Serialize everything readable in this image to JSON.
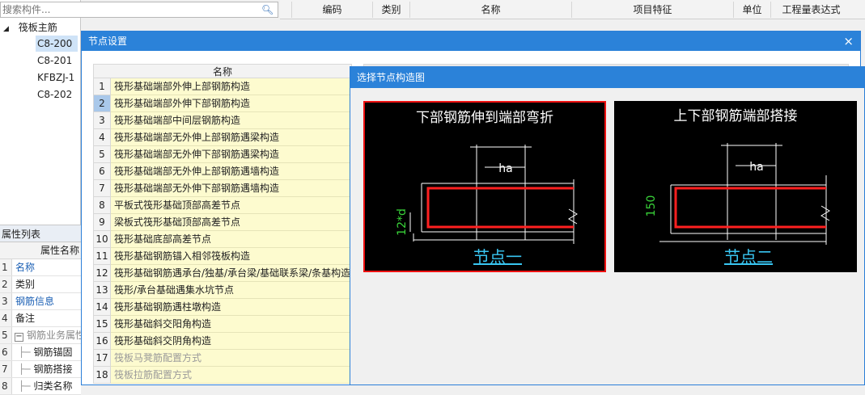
{
  "search": {
    "placeholder": "搜索构件..."
  },
  "tree": {
    "root_label": "筏板主筋",
    "items": [
      "C8-200",
      "C8-201",
      "KFBZJ-1",
      "C8-202"
    ]
  },
  "properties": {
    "header": "属性列表",
    "col_header": "属性名称",
    "rows": [
      {
        "num": "1",
        "name": "名称"
      },
      {
        "num": "2",
        "name": "类别"
      },
      {
        "num": "3",
        "name": "钢筋信息"
      },
      {
        "num": "4",
        "name": "备注"
      },
      {
        "num": "5",
        "name": "钢筋业务属性"
      },
      {
        "num": "6",
        "name": "钢筋锚固"
      },
      {
        "num": "7",
        "name": "钢筋搭接"
      },
      {
        "num": "8",
        "name": "归类名称"
      }
    ]
  },
  "top_grid": {
    "columns": [
      "编码",
      "类别",
      "名称",
      "项目特征",
      "单位",
      "工程量表达式"
    ]
  },
  "node_dialog": {
    "title": "节点设置",
    "close": "×",
    "name_header": "名称",
    "selected_row": 2,
    "rows": [
      {
        "num": "1",
        "name": "筏形基础端部外伸上部钢筋构造"
      },
      {
        "num": "2",
        "name": "筏形基础端部外伸下部钢筋构造"
      },
      {
        "num": "3",
        "name": "筏形基础端部中间层钢筋构造"
      },
      {
        "num": "4",
        "name": "筏形基础端部无外伸上部钢筋遇梁构造"
      },
      {
        "num": "5",
        "name": "筏形基础端部无外伸下部钢筋遇梁构造"
      },
      {
        "num": "6",
        "name": "筏形基础端部无外伸上部钢筋遇墙构造"
      },
      {
        "num": "7",
        "name": "筏形基础端部无外伸下部钢筋遇墙构造"
      },
      {
        "num": "8",
        "name": "平板式筏形基础顶部高差节点"
      },
      {
        "num": "9",
        "name": "梁板式筏形基础顶部高差节点"
      },
      {
        "num": "10",
        "name": "筏形基础底部高差节点"
      },
      {
        "num": "11",
        "name": "筏形基础钢筋锚入相邻筏板构造"
      },
      {
        "num": "12",
        "name": "筏形基础钢筋遇承台/独基/承台梁/基础联系梁/条基构造"
      },
      {
        "num": "13",
        "name": "筏形/承台基础遇集水坑节点"
      },
      {
        "num": "14",
        "name": "筏形基础钢筋遇柱墩构造"
      },
      {
        "num": "15",
        "name": "筏形基础斜交阳角构造"
      },
      {
        "num": "16",
        "name": "筏形基础斜交阴角构造"
      },
      {
        "num": "17",
        "name": "筏板马凳筋配置方式"
      },
      {
        "num": "18",
        "name": "筏板拉筋配置方式"
      }
    ]
  },
  "diagram_dialog": {
    "title": "选择节点构造图",
    "options": [
      {
        "heading": "下部钢筋伸到端部弯折",
        "dim_ha": "ha",
        "dim_side": "12*d",
        "node_label": "节点一",
        "selected": true
      },
      {
        "heading": "上下部钢筋端部搭接",
        "dim_ha": "ha",
        "dim_side": "150",
        "node_label": "节点二",
        "selected": false
      }
    ]
  },
  "colors": {
    "titlebar": "#2b82d9",
    "row_highlight": "#fdfbcf",
    "selected_border": "#e11111",
    "rebar_red": "#ff2020",
    "dim_green": "#39d339",
    "label_cyan": "#39c6f2"
  }
}
